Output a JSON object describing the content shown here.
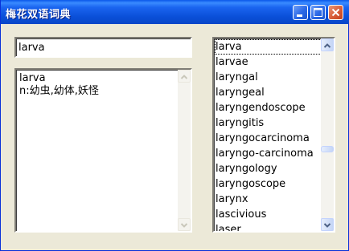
{
  "window": {
    "title": "梅花双语词典"
  },
  "titlebar_buttons": {
    "minimize": "minimize-icon",
    "maximize": "maximize-icon",
    "close": "close-icon"
  },
  "search": {
    "value": "larva"
  },
  "definition": {
    "word": "larva",
    "meaning": "n:幼虫,幼体,妖怪"
  },
  "word_list": {
    "selected": "larva",
    "items": [
      "larva",
      "larvae",
      "laryngal",
      "laryngeal",
      "laryngendoscope",
      "laryngitis",
      "laryngocarcinoma",
      "laryngo-carcinoma",
      "laryngology",
      "laryngoscope",
      "larynx",
      "lascivious",
      "laser"
    ]
  },
  "colors": {
    "titlebar": "#0A58EA",
    "window_face": "#ECE9D8",
    "close_button": "#D85C37"
  }
}
